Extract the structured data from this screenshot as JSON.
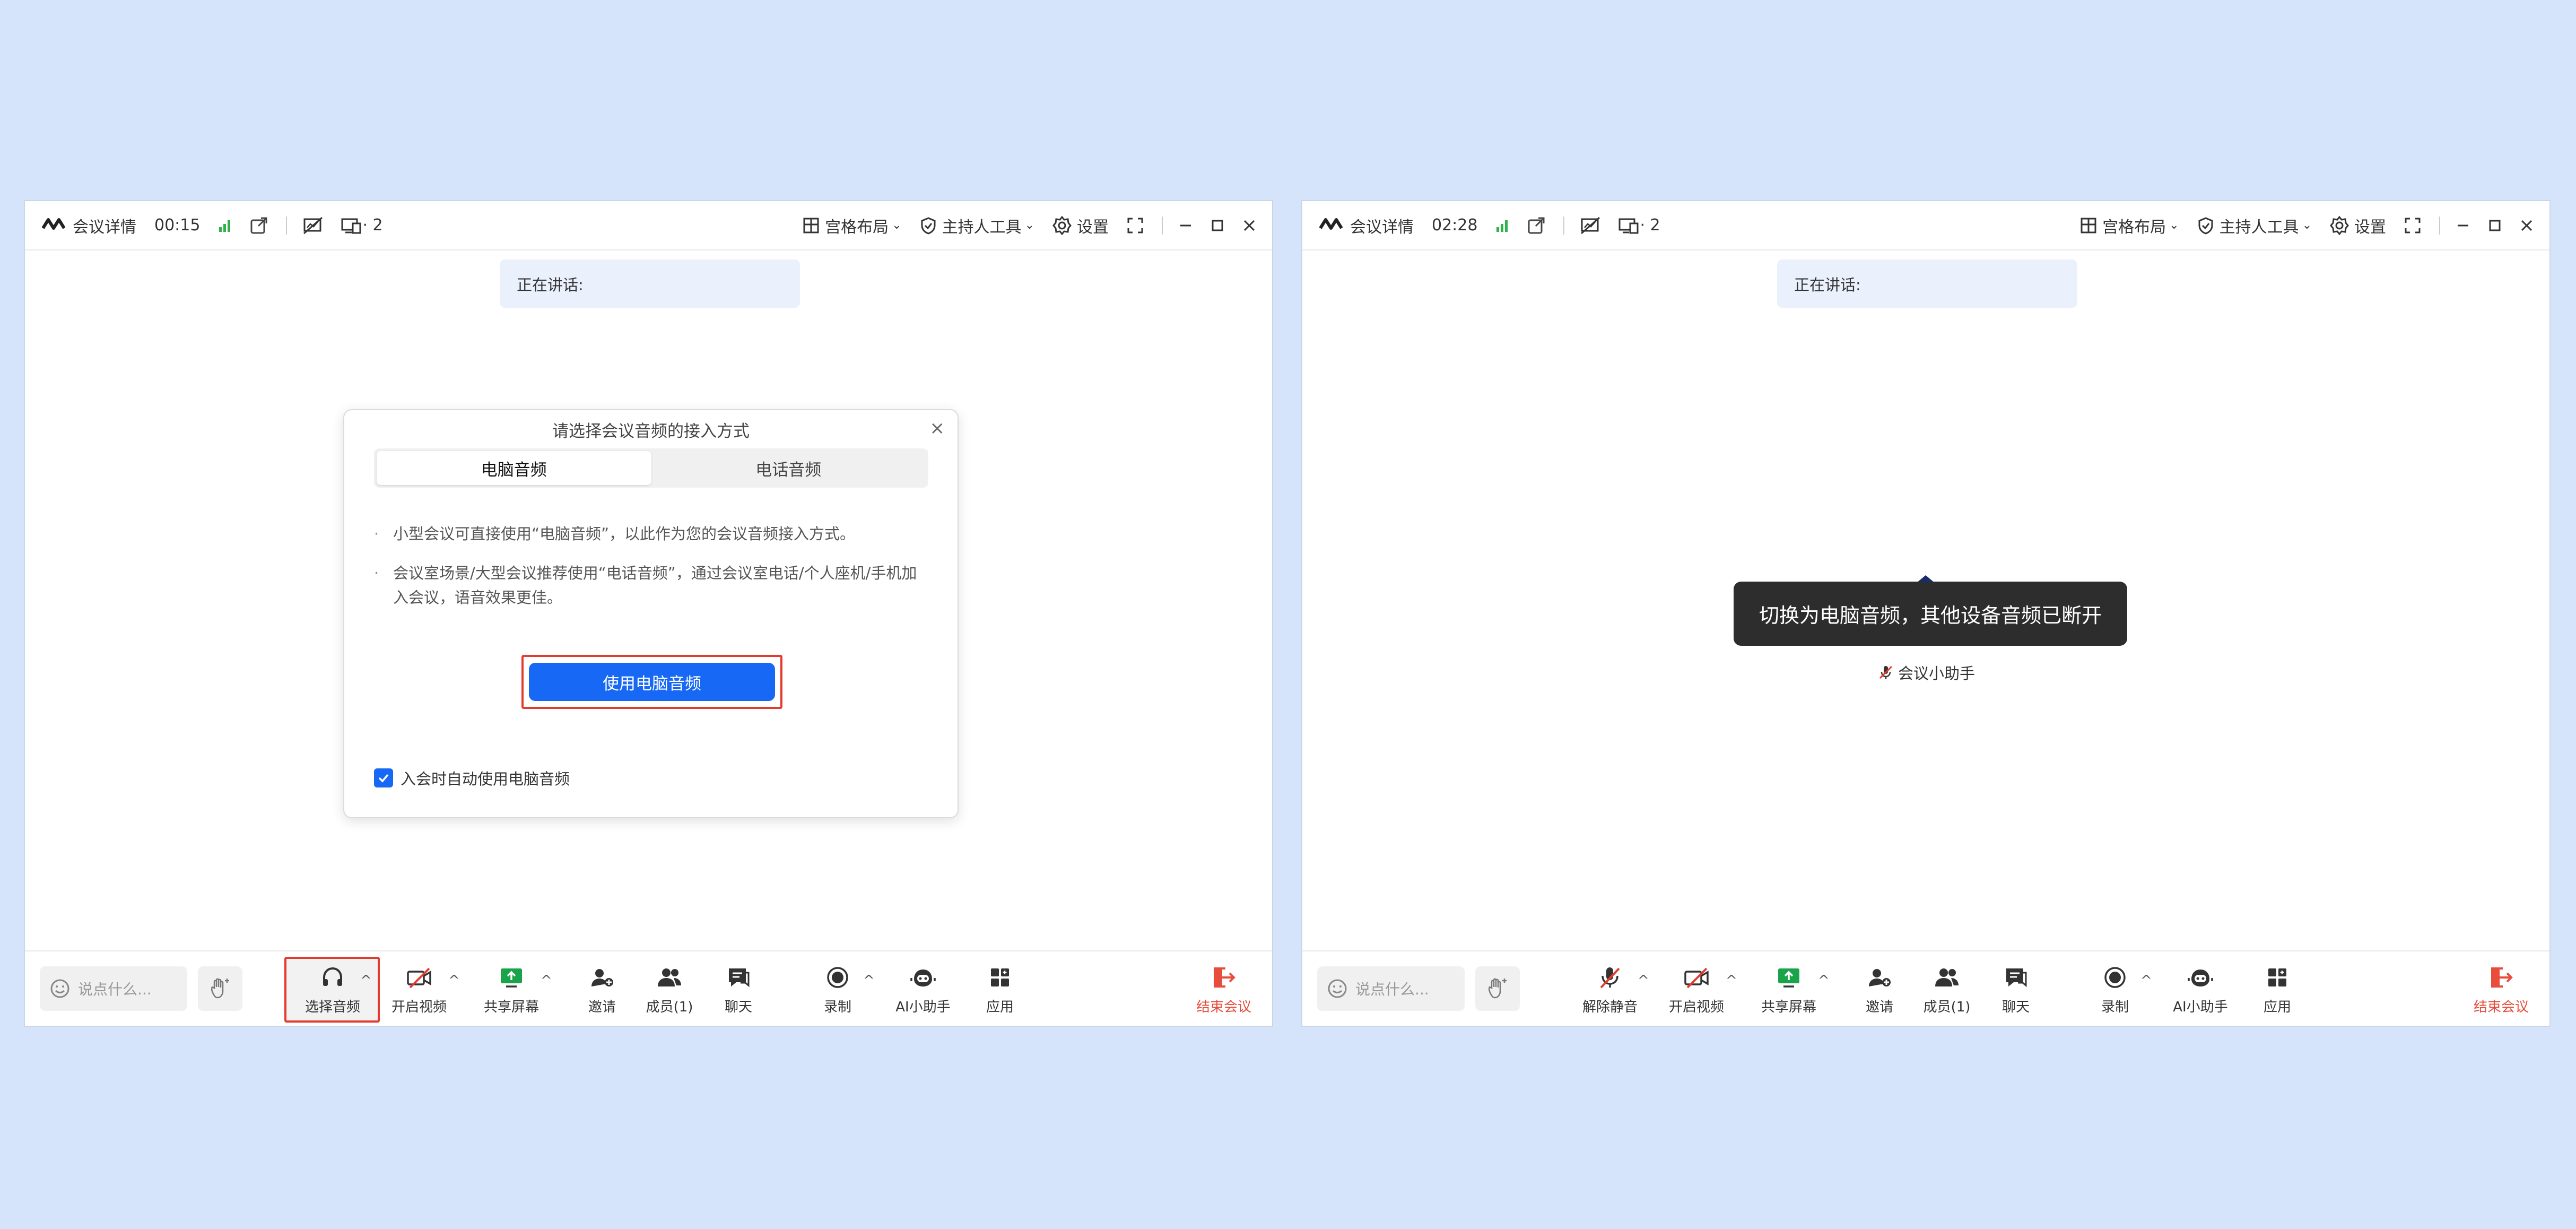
{
  "left_window": {
    "title": "会议详情",
    "timer": "00:15",
    "device_count": "· 2",
    "layout_label": "宫格布局",
    "host_tools_label": "主持人工具",
    "settings_label": "设置",
    "speaking_label": "正在讲话:",
    "dialog": {
      "title": "请选择会议音频的接入方式",
      "tab_computer": "电脑音频",
      "tab_phone": "电话音频",
      "bullet1": "小型会议可直接使用“电脑音频”，以此作为您的会议音频接入方式。",
      "bullet2": "会议室场景/大型会议推荐使用“电话音频”，通过会议室电话/个人座机/手机加入会议，语音效果更佳。",
      "primary_button": "使用电脑音频",
      "auto_checkbox": "入会时自动使用电脑音频",
      "close": "×"
    },
    "toolbar": {
      "chat_placeholder": "说点什么...",
      "audio": "选择音频",
      "video": "开启视频",
      "share": "共享屏幕",
      "invite": "邀请",
      "members": "成员(1)",
      "chat": "聊天",
      "record": "录制",
      "ai": "AI小助手",
      "apps": "应用",
      "end": "结束会议"
    }
  },
  "right_window": {
    "title": "会议详情",
    "timer": "02:28",
    "device_count": "· 2",
    "layout_label": "宫格布局",
    "host_tools_label": "主持人工具",
    "settings_label": "设置",
    "speaking_label": "正在讲话:",
    "toast": "切换为电脑音频，其他设备音频已断开",
    "assistant_label": "会议小助手",
    "toolbar": {
      "chat_placeholder": "说点什么...",
      "unmute": "解除静音",
      "video": "开启视频",
      "share": "共享屏幕",
      "invite": "邀请",
      "members": "成员(1)",
      "chat": "聊天",
      "record": "录制",
      "ai": "AI小助手",
      "apps": "应用",
      "end": "结束会议"
    }
  },
  "colors": {
    "accent": "#1668f5",
    "highlight": "#e33b2e",
    "end": "#e74c3c",
    "background": "#d6e4fb"
  }
}
